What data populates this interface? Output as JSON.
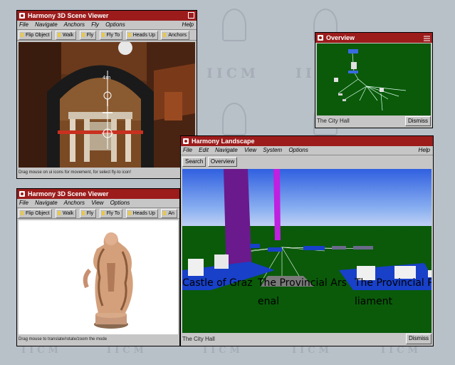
{
  "background": {
    "watermark": "IICM"
  },
  "scene_viewer_top": {
    "title": "Harmony 3D Scene Viewer",
    "menu": [
      "File",
      "Navigate",
      "Anchors",
      "Fly",
      "Options"
    ],
    "help": "Help",
    "tools": [
      "Flip Object",
      "Walk",
      "Fly",
      "Fly To",
      "Heads Up",
      "Anchors"
    ],
    "status": "Drag mouse on ui icons for movement, for select fly-to icon!"
  },
  "scene_viewer_bottom": {
    "title": "Harmony 3D Scene Viewer",
    "menu": [
      "File",
      "Navigate",
      "Anchors",
      "View",
      "Options"
    ],
    "tools": [
      "Flip Object",
      "Walk",
      "Fly",
      "Fly To",
      "Heads Up",
      "An"
    ],
    "status": "Drag mouse to translate/rotate/zoom the mode"
  },
  "overview": {
    "title": "Overview",
    "location": "The City Hall",
    "dismiss": "Dismiss"
  },
  "landscape": {
    "title": "Harmony Landscape",
    "menu": [
      "File",
      "Edit",
      "Navigate",
      "View",
      "System",
      "Options"
    ],
    "help": "Help",
    "buttons": [
      "Search",
      "Overview"
    ],
    "labels3d": [
      "Castle of Graz",
      "The Provincial Ars",
      "enal",
      "The Provincial Pa",
      "liament"
    ],
    "location": "The City Hall",
    "dismiss": "Dismiss"
  },
  "colors": {
    "titlebar": "#9c1c1c",
    "ground": "#0a5a0a",
    "sky_top": "#3a6ae0",
    "pillar_purple": "#6a1a8c",
    "pillar_magenta": "#c020e0"
  }
}
